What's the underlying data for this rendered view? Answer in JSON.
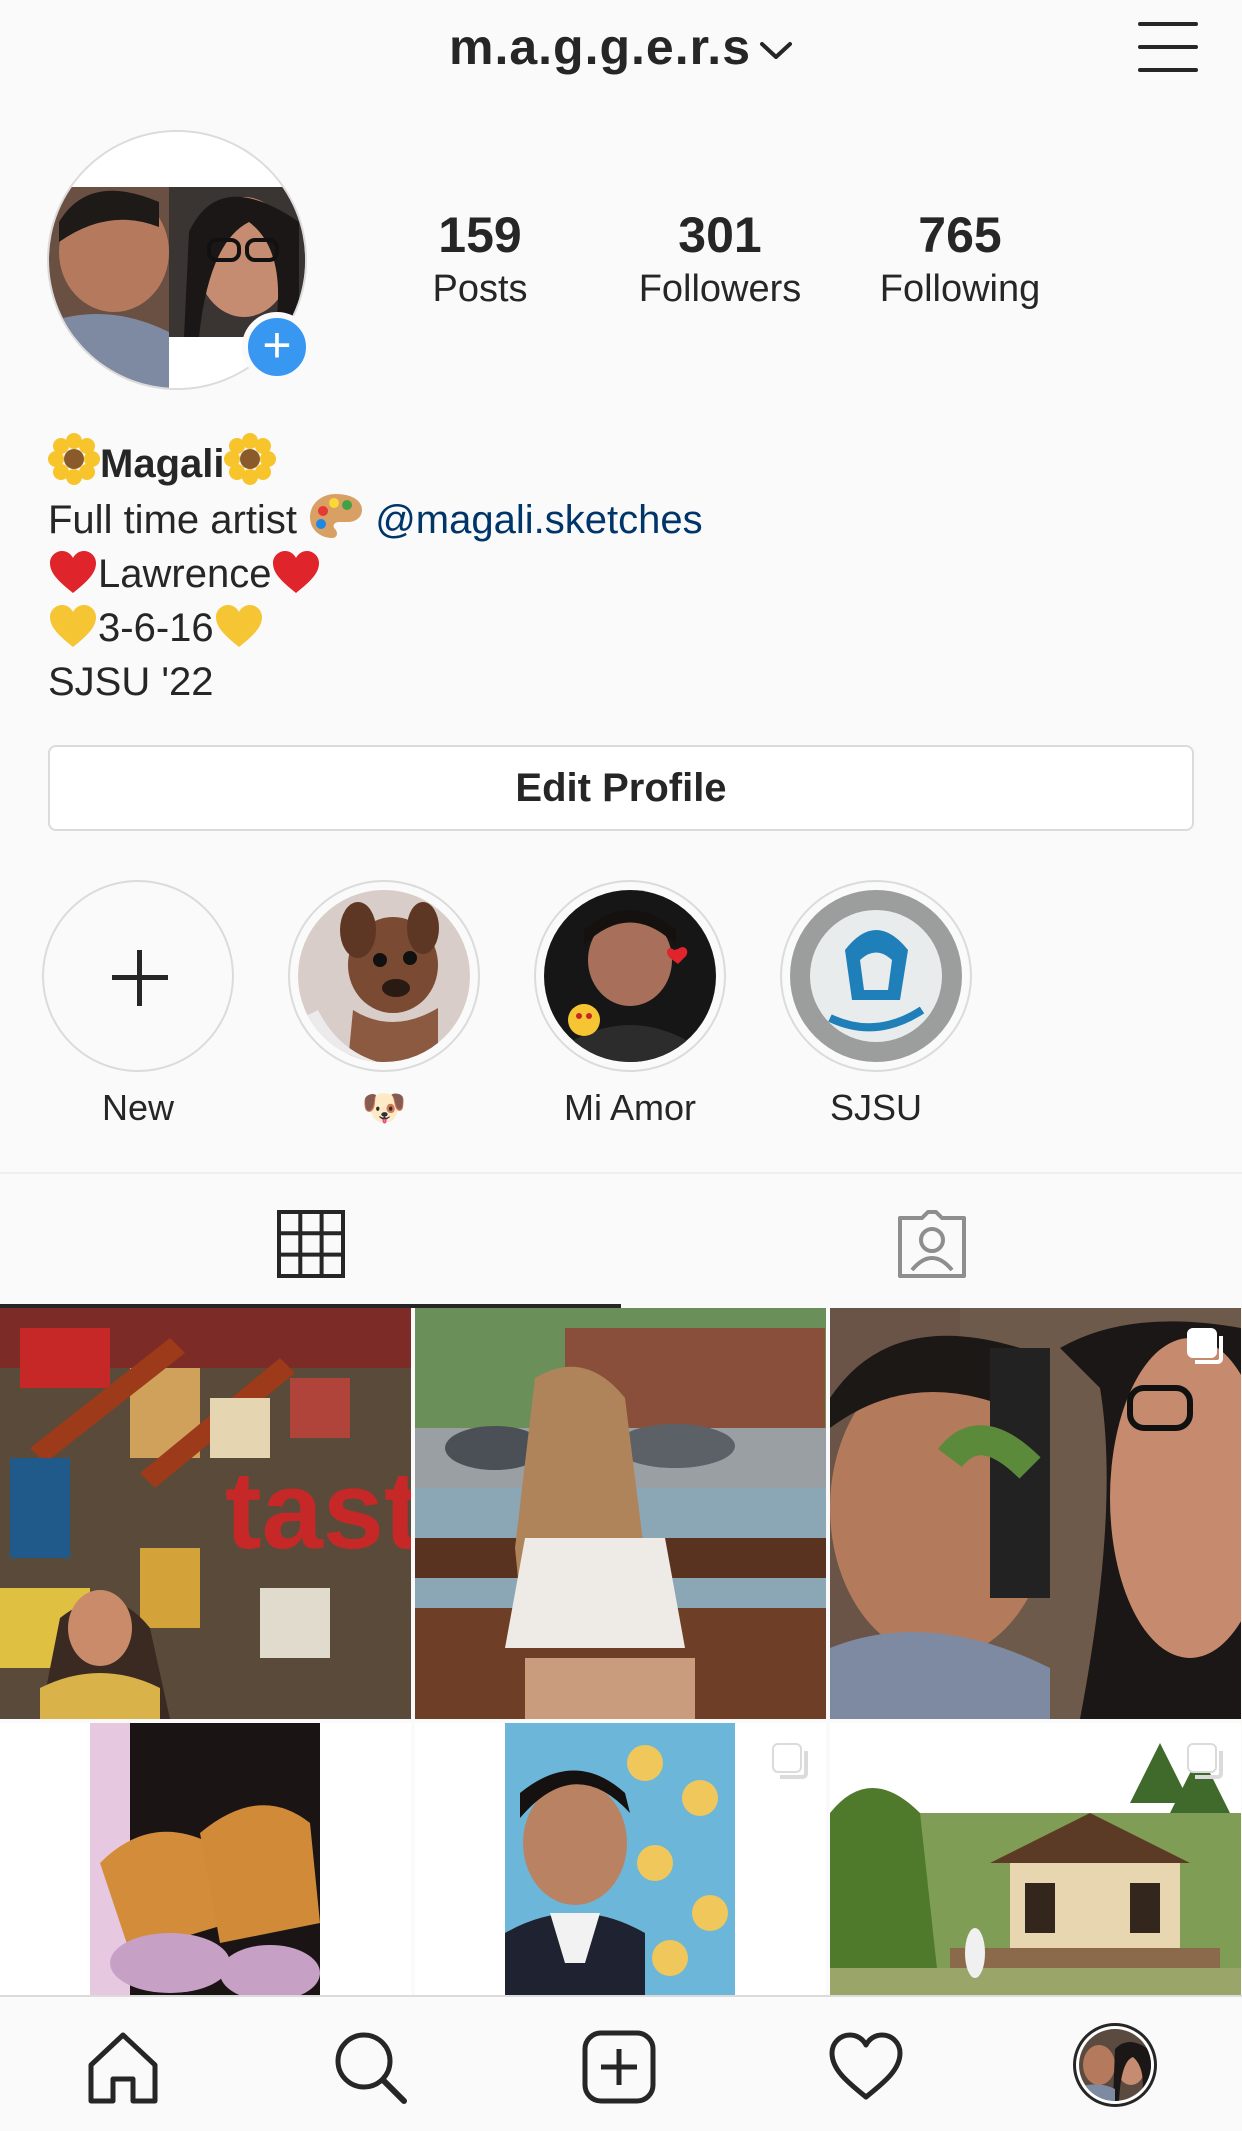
{
  "header": {
    "username": "m.a.g.g.e.r.s",
    "icons": [
      "chevron-down-icon",
      "hamburger-menu-icon"
    ]
  },
  "profile": {
    "add_story_symbol": "+"
  },
  "stats": [
    {
      "num": "159",
      "label": "Posts"
    },
    {
      "num": "301",
      "label": "Followers"
    },
    {
      "num": "765",
      "label": "Following"
    }
  ],
  "bio": {
    "name": "Magali",
    "line1_text": "Full time artist",
    "mention": "@magali.sketches",
    "line2_text": "Lawrence",
    "line3_text": "3-6-16",
    "line4_text": "SJSU '22"
  },
  "edit_profile_label": "Edit Profile",
  "highlights": [
    {
      "label": "New"
    },
    {
      "label": "🐶"
    },
    {
      "label": "Mi Amor"
    },
    {
      "label": "SJSU"
    }
  ],
  "tabs": [
    {
      "icon": "grid-icon",
      "active": true
    },
    {
      "icon": "tagged-icon",
      "active": false
    }
  ],
  "nav": [
    "home-icon",
    "search-icon",
    "new-post-icon",
    "heart-icon",
    "profile-avatar"
  ],
  "colors": {
    "accent": "#3897f0",
    "mention": "#003569",
    "text": "#262626",
    "border": "#dbdbdb",
    "background": "#fafafa"
  }
}
